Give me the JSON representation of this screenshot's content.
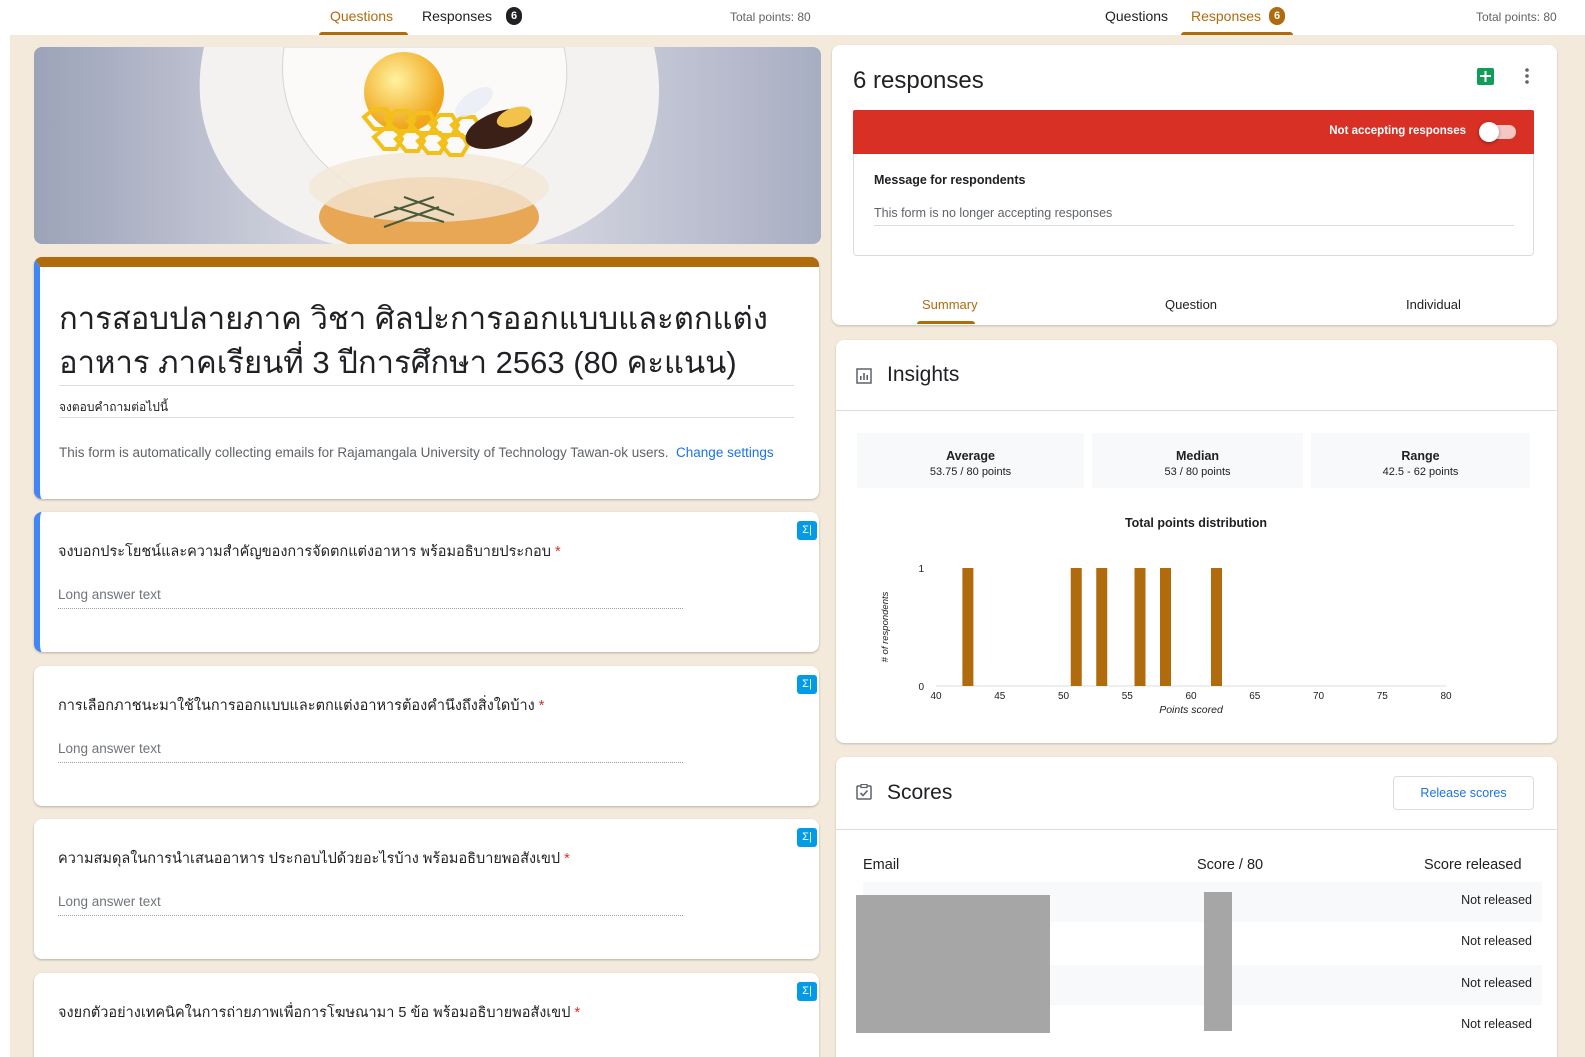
{
  "left": {
    "tabs": {
      "questions": "Questions",
      "responses": "Responses",
      "responses_count": "6"
    },
    "total_points": "Total points: 80",
    "form": {
      "title": "การสอบปลายภาค วิชา ศิลปะการออกแบบและตกแต่งอาหาร ภาคเรียนที่ 3 ปีการศึกษา 2563 (80 คะแนน)",
      "description": "จงตอบคำถามต่อไปนี้",
      "email_note": "This form is automatically collecting emails for Rajamangala University of Technology Tawan-ok users.",
      "change_settings": "Change settings"
    },
    "questions": [
      {
        "text": "จงบอกประโยชน์และความสำคัญของการจัดตกแต่งอาหาร พร้อมอธิบายประกอบ",
        "required": "*",
        "answer_placeholder": "Long answer text"
      },
      {
        "text": "การเลือกภาชนะมาใช้ในการออกแบบและตกแต่งอาหารต้องคำนึงถึงสิ่งใดบ้าง",
        "required": "*",
        "answer_placeholder": "Long answer text"
      },
      {
        "text": "ความสมดุลในการนำเสนออาหาร ประกอบไปด้วยอะไรบ้าง พร้อมอธิบายพอสังเขป",
        "required": "*",
        "answer_placeholder": "Long answer text"
      },
      {
        "text": "จงยกตัวอย่างเทคนิคในการถ่ายภาพเพื่อการโฆษณามา 5 ข้อ พร้อมอธิบายพอสังเขป",
        "required": "*",
        "answer_placeholder": ""
      }
    ],
    "badge_symbol": "Σ|"
  },
  "right": {
    "tabs": {
      "questions": "Questions",
      "responses": "Responses",
      "responses_count": "6"
    },
    "total_points": "Total points: 80",
    "responses_title": "6 responses",
    "not_accepting_label": "Not accepting responses",
    "message": {
      "title": "Message for respondents",
      "text": "This form is no longer accepting responses"
    },
    "sub_tabs": [
      "Summary",
      "Question",
      "Individual"
    ],
    "insights": {
      "title": "Insights",
      "stats": [
        {
          "label": "Average",
          "value": "53.75 / 80 points"
        },
        {
          "label": "Median",
          "value": "53 / 80 points"
        },
        {
          "label": "Range",
          "value": "42.5 - 62 points"
        }
      ]
    },
    "scores": {
      "title": "Scores",
      "release_button": "Release scores",
      "headers": {
        "email": "Email",
        "score": "Score / 80",
        "released": "Score released"
      },
      "rows": [
        "Not released",
        "Not released",
        "Not released",
        "Not released"
      ]
    }
  },
  "colors": {
    "accent": "#b06b0d",
    "not_accepting": "#d93025",
    "link": "#1a73e8",
    "badge": "#039be5"
  },
  "chart_data": {
    "type": "bar",
    "title": "Total points distribution",
    "xlabel": "Points scored",
    "ylabel": "# of respondents",
    "xlim": [
      40,
      80
    ],
    "ylim": [
      0,
      1
    ],
    "xticks": [
      40,
      45,
      50,
      55,
      60,
      65,
      70,
      75,
      80
    ],
    "yticks": [
      0,
      1
    ],
    "x": [
      42.5,
      51,
      53,
      56,
      58,
      62
    ],
    "values": [
      1,
      1,
      1,
      1,
      1,
      1
    ],
    "color": "#b06b0d"
  }
}
